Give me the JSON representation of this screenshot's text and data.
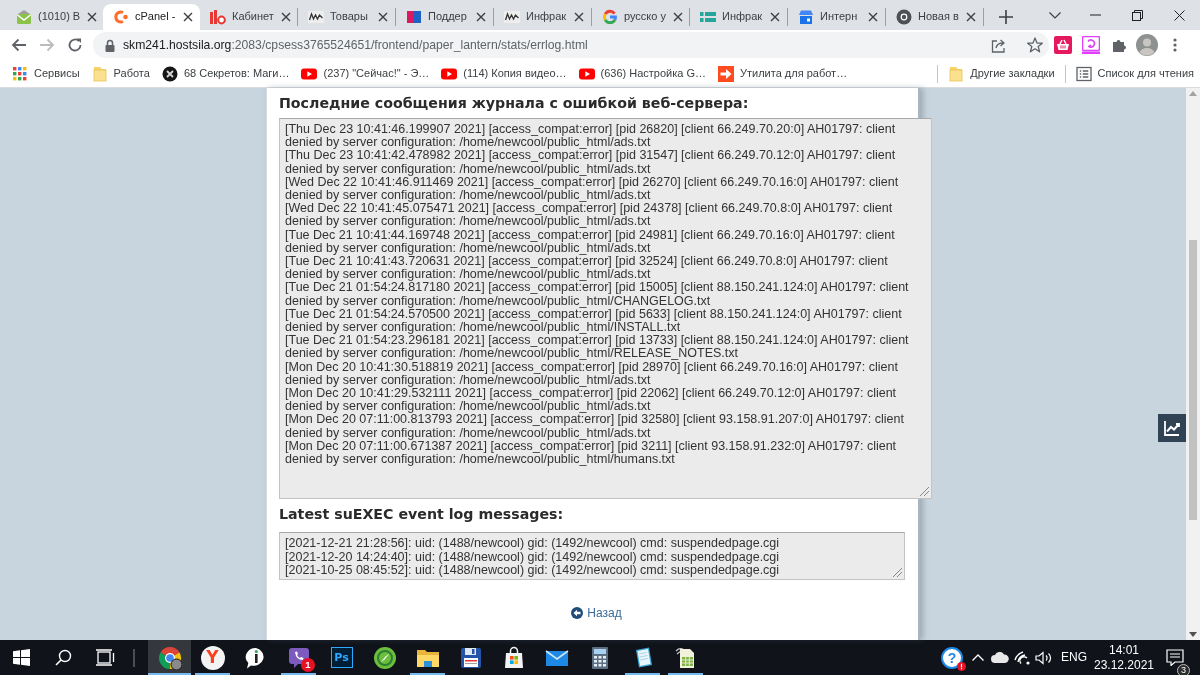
{
  "browser": {
    "tabs": [
      {
        "title": "(1010) В",
        "kind": "mail",
        "selected": false
      },
      {
        "title": "cPanel -",
        "kind": "cpanel",
        "selected": true
      },
      {
        "title": "Кабинет",
        "kind": "bars",
        "selected": false
      },
      {
        "title": "Товары",
        "kind": "new",
        "selected": false
      },
      {
        "title": "Поддер",
        "kind": "ns",
        "selected": false
      },
      {
        "title": "Инфрак",
        "kind": "new",
        "selected": false
      },
      {
        "title": "русско у",
        "kind": "google",
        "selected": false
      },
      {
        "title": "Инфрак",
        "kind": "sheet",
        "selected": false
      },
      {
        "title": "Интерн",
        "kind": "store",
        "selected": false
      },
      {
        "title": "Новая в",
        "kind": "chrome",
        "selected": false
      }
    ],
    "nav_buttons": [
      {
        "kind": "back",
        "disabled": false
      },
      {
        "kind": "forward",
        "disabled": true
      },
      {
        "kind": "reload",
        "disabled": false
      }
    ],
    "address": {
      "host": "skm241.hostsila.org",
      "path": ":2083/cpsess3765524651/frontend/paper_lantern/stats/errlog.html"
    },
    "bookmarks": [
      {
        "label": "Сервисы",
        "kind": "apps"
      },
      {
        "label": "Работа",
        "kind": "folder"
      },
      {
        "label": "68 Секретов: Маги…",
        "kind": "xcircle"
      },
      {
        "label": "(237) \"Сейчас!\" - Э…",
        "kind": "youtube"
      },
      {
        "label": "(114) Копия видео…",
        "kind": "youtube"
      },
      {
        "label": "(636) Настройка G…",
        "kind": "youtube"
      },
      {
        "label": "Утилита для работ…",
        "kind": "arrow"
      }
    ],
    "bookmarks_right": [
      {
        "label": "Другие закладки",
        "kind": "folder"
      },
      {
        "label": "Список для чтения",
        "kind": "list"
      }
    ]
  },
  "page": {
    "error_log": {
      "title": "Последние сообщения журнала с ошибкой веб-сервера:",
      "entries": [
        "[Thu Dec 23 10:41:46.199907 2021] [access_compat:error] [pid 26820] [client 66.249.70.20:0] AH01797: client denied by server configuration: /home/newcool/public_html/ads.txt",
        "[Thu Dec 23 10:41:42.478982 2021] [access_compat:error] [pid 31547] [client 66.249.70.12:0] AH01797: client denied by server configuration: /home/newcool/public_html/ads.txt",
        "[Wed Dec 22 10:41:46.911469 2021] [access_compat:error] [pid 26270] [client 66.249.70.16:0] AH01797: client denied by server configuration: /home/newcool/public_html/ads.txt",
        "[Wed Dec 22 10:41:45.075471 2021] [access_compat:error] [pid 24378] [client 66.249.70.8:0] AH01797: client denied by server configuration: /home/newcool/public_html/ads.txt",
        "[Tue Dec 21 10:41:44.169748 2021] [access_compat:error] [pid 24981] [client 66.249.70.16:0] AH01797: client denied by server configuration: /home/newcool/public_html/ads.txt",
        "[Tue Dec 21 10:41:43.720631 2021] [access_compat:error] [pid 32524] [client 66.249.70.8:0] AH01797: client denied by server configuration: /home/newcool/public_html/ads.txt",
        "[Tue Dec 21 01:54:24.817180 2021] [access_compat:error] [pid 15005] [client 88.150.241.124:0] AH01797: client denied by server configuration: /home/newcool/public_html/CHANGELOG.txt",
        "[Tue Dec 21 01:54:24.570500 2021] [access_compat:error] [pid 5633] [client 88.150.241.124:0] AH01797: client denied by server configuration: /home/newcool/public_html/INSTALL.txt",
        "[Tue Dec 21 01:54:23.296181 2021] [access_compat:error] [pid 13733] [client 88.150.241.124:0] AH01797: client denied by server configuration: /home/newcool/public_html/RELEASE_NOTES.txt",
        "[Mon Dec 20 10:41:30.518819 2021] [access_compat:error] [pid 28970] [client 66.249.70.16:0] AH01797: client denied by server configuration: /home/newcool/public_html/ads.txt",
        "[Mon Dec 20 10:41:29.532111 2021] [access_compat:error] [pid 22062] [client 66.249.70.12:0] AH01797: client denied by server configuration: /home/newcool/public_html/ads.txt",
        "[Mon Dec 20 07:11:00.813793 2021] [access_compat:error] [pid 32580] [client 93.158.91.207:0] AH01797: client denied by server configuration: /home/newcool/public_html/ads.txt",
        "[Mon Dec 20 07:11:00.671387 2021] [access_compat:error] [pid 3211] [client 93.158.91.232:0] AH01797: client denied by server configuration: /home/newcool/public_html/humans.txt"
      ]
    },
    "suexec_log": {
      "title": "Latest suEXEC event log messages:",
      "entries": [
        "[2021-12-21 21:28:56]: uid: (1488/newcool) gid: (1492/newcool) cmd: suspendedpage.cgi",
        "[2021-12-20 14:24:40]: uid: (1488/newcool) gid: (1492/newcool) cmd: suspendedpage.cgi",
        "[2021-10-25 08:45:52]: uid: (1488/newcool) gid: (1492/newcool) cmd: suspendedpage.cgi"
      ]
    },
    "back_link": "Назад"
  },
  "taskbar": {
    "apps": [
      {
        "kind": "chrome",
        "running": true,
        "selected": true
      },
      {
        "kind": "yandex",
        "label": "Y",
        "running": true,
        "selected": false
      },
      {
        "kind": "bubble",
        "running": false,
        "selected": false
      },
      {
        "kind": "viber",
        "badge": "1",
        "running": true,
        "selected": false
      },
      {
        "kind": "ps",
        "label": "Ps",
        "running": false,
        "selected": false
      },
      {
        "kind": "compass",
        "running": false,
        "selected": false
      },
      {
        "kind": "folder",
        "running": true,
        "selected": false
      },
      {
        "kind": "floppy",
        "running": false,
        "selected": false
      },
      {
        "kind": "store",
        "running": false,
        "selected": false
      },
      {
        "kind": "mail",
        "running": false,
        "selected": false
      },
      {
        "kind": "calculator",
        "running": false,
        "selected": false
      },
      {
        "kind": "notebook",
        "running": true,
        "selected": false
      },
      {
        "kind": "spreadsheet",
        "running": true,
        "selected": false
      }
    ],
    "tray": [
      {
        "kind": "help",
        "label": "?"
      },
      {
        "kind": "chevron"
      },
      {
        "kind": "cloud"
      },
      {
        "kind": "wifi"
      },
      {
        "kind": "volume"
      }
    ],
    "language": "ENG",
    "time": "14:01",
    "date": "23.12.2021",
    "notifications": "3"
  }
}
